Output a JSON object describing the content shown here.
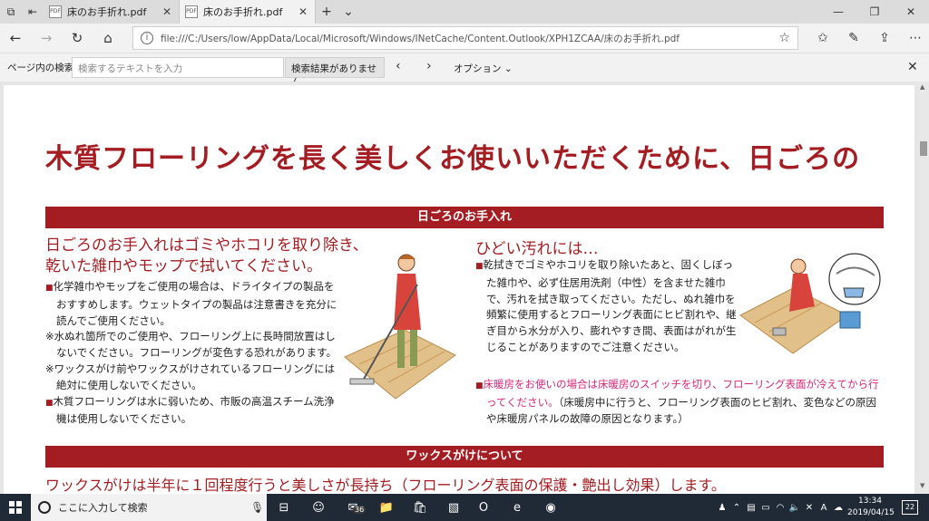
{
  "browser": {
    "tabs": [
      {
        "label": "床のお手折れ.pdf",
        "favicon": "PDF"
      },
      {
        "label": "床のお手折れ.pdf",
        "favicon": "PDF"
      }
    ],
    "url": "file:///C:/Users/low/AppData/Local/Microsoft/Windows/INetCache/Content.Outlook/XPH1ZCAA/床のお手折れ.pdf"
  },
  "findbar": {
    "label": "ページ内の検索",
    "placeholder": "検索するテキストを入力",
    "result": "検索結果がありません",
    "options": "オプション"
  },
  "document": {
    "title": "木質フローリングを長く美しくお使いいただくために、日ごろの",
    "section1": "日ごろのお手入れ",
    "left_head_1": "日ごろのお手入れはゴミやホコリを取り除き、",
    "left_head_2": "乾いた雑巾やモップで拭いてください。",
    "left_items": [
      "化学雑巾やモップをご使用の場合は、ドライタイプの製品をおすすめします。ウェットタイプの製品は注意書きを充分に読んでご使用ください。",
      "※水ぬれ箇所でのご使用や、フローリング上に長時間放置はしないでください。フローリングが変色する恐れがあります。",
      "※ワックスがけ前やワックスがけされているフローリングには絶対に使用しないでください。",
      "木質フローリングは水に弱いため、市販の高温スチーム洗浄機は使用しないでください。"
    ],
    "right_head": "ひどい汚れには…",
    "right_item1": "乾拭きでゴミやホコリを取り除いたあと、固くしぼった雑巾や、必ず住居用洗剤（中性）を含ませた雑巾で、汚れを拭き取ってください。ただし、ぬれ雑巾を頻繁に使用するとフローリング表面にヒビ割れや、継ぎ目から水分が入り、膨れやすき間、表面はがれが生じることがありますのでご注意ください。",
    "right_item2_pink": "床暖房をお使いの場合は床暖房のスイッチを切り、フローリング表面が冷えてから行ってください。",
    "right_item2_rest": "（床暖房中に行うと、フローリング表面のヒビ割れ、変色などの原因や床暖房パネルの故障の原因となります。）",
    "section2": "ワックスがけについて",
    "wax_line": "ワックスがけは半年に１回程度行うと美しさが長持ち（フローリング表面の保護・艶出し効果）します。"
  },
  "taskbar": {
    "search_placeholder": "ここに入力して検索",
    "badge": "36",
    "time": "13:34",
    "date": "2019/04/15",
    "notifications": "22"
  }
}
